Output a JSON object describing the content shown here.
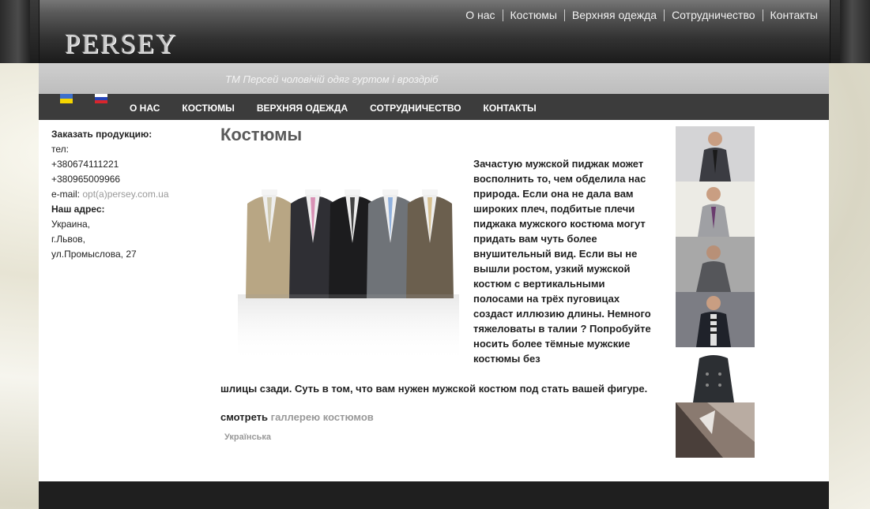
{
  "header": {
    "logo": "PERSEY",
    "top_nav": [
      "О нас",
      "Костюмы",
      "Верхняя одежда",
      "Сотрудничество",
      "Контакты"
    ],
    "tagline": "ТМ Персей чоловічій одяг гуртом і вроздріб"
  },
  "menu": [
    "О НАС",
    "КОСТЮМЫ",
    "ВЕРХНЯЯ ОДЕЖДА",
    "СОТРУДНИЧЕСТВО",
    "КОНТАКТЫ"
  ],
  "sidebar": {
    "order_title": "Заказать продукцию:",
    "phone_label": "тел:",
    "phone1": "+380674111221",
    "phone2": "+380965009966",
    "email_label": "e-mail:",
    "email": "opt(a)persey.com.ua",
    "address_title": "Наш адрес:",
    "country": "Украина,",
    "city": "г.Львов,",
    "street": "ул.Промыслова, 27"
  },
  "main": {
    "title": "Костюмы",
    "article_part1": "Зачастую мужской пиджак может восполнить то, чем обделила нас природа. Если она не дала вам широких плеч, подбитые плечи пиджака мужского костюма могут придать вам чуть более внушительный вид. Если вы не вышли ростом, узкий мужской костюм с вертикальными полосами на трёх пуговицах создаст иллюзию длины. Немного тяжеловаты в талии ? Попробуйте носить более тёмные мужские костюмы без",
    "article_part2": "шлицы сзади. Суть в том, что вам нужен мужской костюм под стать вашей фигуре.",
    "gallery_prefix": "смотреть",
    "gallery_link": "галлерею костюмов",
    "language_link": "Українська"
  },
  "colors": {
    "suit_colors": [
      "#b8a684",
      "#2f2f34",
      "#1c1c1e",
      "#6f7378",
      "#6b5f4e"
    ],
    "tie_colors": [
      "#cfc9b0",
      "#d991b5",
      "#444",
      "#8fb0dd",
      "#d7c08f"
    ]
  }
}
